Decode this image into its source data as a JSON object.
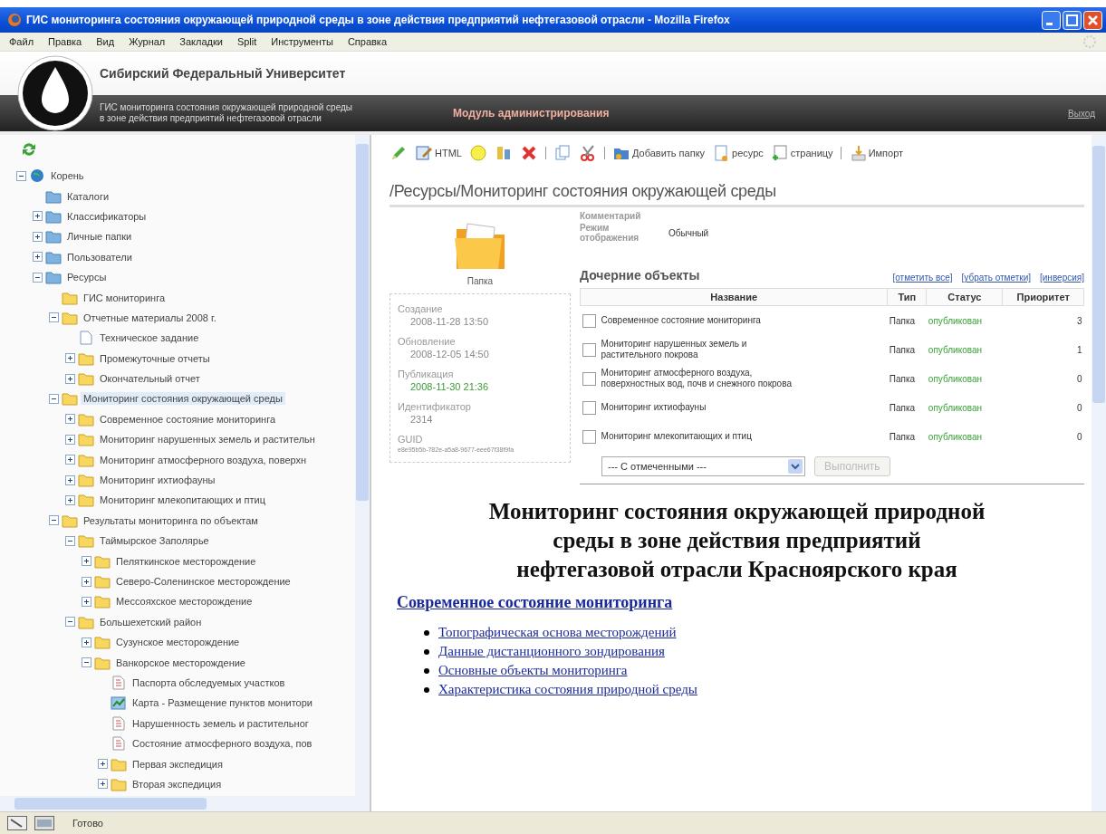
{
  "window": {
    "title": "ГИС мониторинга состояния окружающей природной среды в зоне действия предприятий нефтегазовой отрасли - Mozilla Firefox"
  },
  "menu": [
    "Файл",
    "Правка",
    "Вид",
    "Журнал",
    "Закладки",
    "Split",
    "Инструменты",
    "Справка"
  ],
  "header": {
    "university": "Сибирский Федеральный Университет",
    "subtitle_lines": [
      "ГИС мониторинга состояния окружающей природной среды",
      "в зоне действия предприятий нефтегазовой отрасли"
    ],
    "module": "Модуль администрирования",
    "logout": "Выход"
  },
  "tree": [
    {
      "label": "Корень",
      "kind": "root",
      "expanded": true,
      "selected": false,
      "children": [
        {
          "label": "Каталоги",
          "kind": "folder-blue",
          "selected": false
        },
        {
          "label": "Классификаторы",
          "kind": "folder-blue",
          "expanded": false,
          "selected": false
        },
        {
          "label": "Личные папки",
          "kind": "folder-blue",
          "expanded": false,
          "selected": false
        },
        {
          "label": "Пользователи",
          "kind": "folder-blue",
          "expanded": false,
          "selected": false
        },
        {
          "label": "Ресурсы",
          "kind": "folder-blue",
          "expanded": true,
          "selected": false,
          "children": [
            {
              "label": "ГИС мониторинга",
              "kind": "folder",
              "selected": false
            },
            {
              "label": "Отчетные материалы 2008 г.",
              "kind": "folder",
              "expanded": true,
              "selected": false,
              "children": [
                {
                  "label": "Техническое задание",
                  "kind": "document",
                  "selected": false
                },
                {
                  "label": "Промежуточные отчеты",
                  "kind": "folder",
                  "expanded": false,
                  "selected": false
                },
                {
                  "label": "Окончательный отчет",
                  "kind": "folder",
                  "expanded": false,
                  "selected": false
                }
              ]
            },
            {
              "label": "Мониторинг состояния окружающей среды",
              "kind": "folder",
              "expanded": true,
              "selected": true,
              "children": [
                {
                  "label": "Современное состояние мониторинга",
                  "kind": "folder",
                  "expanded": false,
                  "selected": false
                },
                {
                  "label": "Мониторинг нарушенных земель и растительн",
                  "kind": "folder",
                  "expanded": false,
                  "selected": false
                },
                {
                  "label": "Мониторинг атмосферного воздуха, поверхн",
                  "kind": "folder",
                  "expanded": false,
                  "selected": false
                },
                {
                  "label": "Мониторинг ихтиофауны",
                  "kind": "folder",
                  "expanded": false,
                  "selected": false
                },
                {
                  "label": "Мониторинг млекопитающих и птиц",
                  "kind": "folder",
                  "expanded": false,
                  "selected": false
                }
              ]
            },
            {
              "label": "Результаты мониторинга по объектам",
              "kind": "folder",
              "expanded": true,
              "selected": false,
              "children": [
                {
                  "label": "Таймырское Заполярье",
                  "kind": "folder",
                  "expanded": true,
                  "selected": false,
                  "children": [
                    {
                      "label": "Пеляткинское месторождение",
                      "kind": "folder",
                      "expanded": false,
                      "selected": false
                    },
                    {
                      "label": "Северо-Соленинское месторождение",
                      "kind": "folder",
                      "expanded": false,
                      "selected": false
                    },
                    {
                      "label": "Мессояхское месторождение",
                      "kind": "folder",
                      "expanded": false,
                      "selected": false
                    }
                  ]
                },
                {
                  "label": "Большехетский район",
                  "kind": "folder",
                  "expanded": true,
                  "selected": false,
                  "children": [
                    {
                      "label": "Сузунское месторождение",
                      "kind": "folder",
                      "expanded": false,
                      "selected": false
                    },
                    {
                      "label": "Ванкорское месторождение",
                      "kind": "folder",
                      "expanded": true,
                      "selected": false,
                      "children": [
                        {
                          "label": "Паспорта обследуемых участков",
                          "kind": "document-text",
                          "selected": false
                        },
                        {
                          "label": "Карта - Размещение пунктов монитори",
                          "kind": "map",
                          "selected": false
                        },
                        {
                          "label": "Нарушенность земель и растительног",
                          "kind": "document-text",
                          "selected": false
                        },
                        {
                          "label": "Состояние атмосферного воздуха, пов",
                          "kind": "document-text",
                          "selected": false
                        },
                        {
                          "label": "Первая экспедиция",
                          "kind": "folder",
                          "expanded": false,
                          "selected": false
                        },
                        {
                          "label": "Вторая экспедиция",
                          "kind": "folder",
                          "expanded": false,
                          "selected": false
                        }
                      ]
                    }
                  ]
                }
              ]
            }
          ]
        }
      ]
    }
  ],
  "toolbar": [
    {
      "kind": "icon"
    },
    {
      "kind": "icon",
      "label": "HTML"
    },
    {
      "kind": "icon"
    },
    {
      "kind": "icon"
    },
    {
      "kind": "icon"
    },
    {
      "kind": "separator"
    },
    {
      "kind": "icon"
    },
    {
      "kind": "icon"
    },
    {
      "kind": "separator"
    },
    {
      "kind": "icon",
      "label": "Добавить папку"
    },
    {
      "kind": "icon",
      "label": "ресурс"
    },
    {
      "kind": "icon",
      "label": "страницу"
    },
    {
      "kind": "separator"
    },
    {
      "kind": "icon",
      "label": "Импорт"
    }
  ],
  "path": "/Ресурсы/Мониторинг состояния окружающей среды",
  "object": {
    "type_label": "Папка",
    "meta": [
      {
        "label": "Создание",
        "value": "2008-11-28 13:50",
        "kind": "plain"
      },
      {
        "label": "Обновление",
        "value": "2008-12-05 14:50",
        "kind": "plain"
      },
      {
        "label": "Публикация",
        "value": "2008-11-30 21:36",
        "kind": "published"
      },
      {
        "label": "Идентификатор",
        "value": "2314",
        "kind": "plain"
      },
      {
        "label": "GUID",
        "value": "e8e95b5b-782e-a5a8-9677-eee67f38f9fa",
        "kind": "small"
      }
    ],
    "comment_label": "Комментарий",
    "display_mode_label": "Режим отображения",
    "display_mode": "Обычный"
  },
  "children_section": {
    "title": "Дочерние объекты",
    "links": [
      "[отметить все]",
      "[убрать отметки]",
      "[инверсия]"
    ],
    "columns": [
      "Название",
      "Тип",
      "Статус",
      "Приоритет"
    ],
    "rows": [
      {
        "name": "Современное состояние мониторинга",
        "type": "Папка",
        "status": "опубликован",
        "priority": "3",
        "checked": false
      },
      {
        "name": "Мониторинг нарушенных земель и растительного покрова",
        "type": "Папка",
        "status": "опубликован",
        "priority": "1",
        "checked": false
      },
      {
        "name": "Мониторинг атмосферного воздуха, поверхностных вод, почв и снежного покрова",
        "type": "Папка",
        "status": "опубликован",
        "priority": "0",
        "checked": false
      },
      {
        "name": "Мониторинг ихтиофауны",
        "type": "Папка",
        "status": "опубликован",
        "priority": "0",
        "checked": false
      },
      {
        "name": "Мониторинг млекопитающих и птиц",
        "type": "Папка",
        "status": "опубликован",
        "priority": "0",
        "checked": false
      }
    ],
    "action_select": "--- С отмеченными ---",
    "action_button": {
      "label": "Выполнить",
      "disabled": true
    }
  },
  "article": {
    "title": "Мониторинг состояния окружающей природной среды в зоне действия предприятий нефтегазовой отрасли Красноярского края",
    "section": "Современное состояние мониторинга",
    "items": [
      "Топографическая основа месторождений",
      "Данные дистанционного зондирования",
      "Основные объекты мониторинга",
      "Характеристика состояния природной среды"
    ]
  },
  "status_bar": {
    "text": "Готово"
  }
}
